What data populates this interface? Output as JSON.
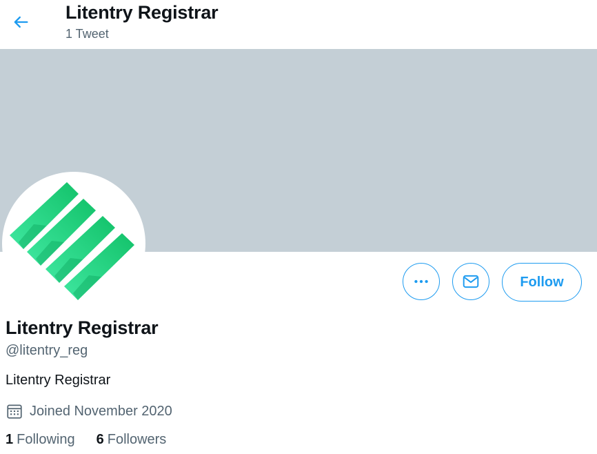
{
  "colors": {
    "accent": "#1d9bf0",
    "banner": "#c4cfd6",
    "secondary_text": "#536471",
    "primary_text": "#0f1419",
    "logo_green": "#1ed47d"
  },
  "header": {
    "back_icon": "arrow-left-icon",
    "title": "Litentry Registrar",
    "tweet_count": "1 Tweet"
  },
  "profile": {
    "avatar_icon": "litentry-logo",
    "display_name": "Litentry Registrar",
    "handle": "@litentry_reg",
    "bio": "Litentry Registrar",
    "joined_icon": "calendar-icon",
    "joined": "Joined November 2020",
    "following_count": "1",
    "following_label": "Following",
    "followers_count": "6",
    "followers_label": "Followers"
  },
  "actions": {
    "more_icon": "more-icon",
    "message_icon": "mail-icon",
    "follow_label": "Follow"
  }
}
